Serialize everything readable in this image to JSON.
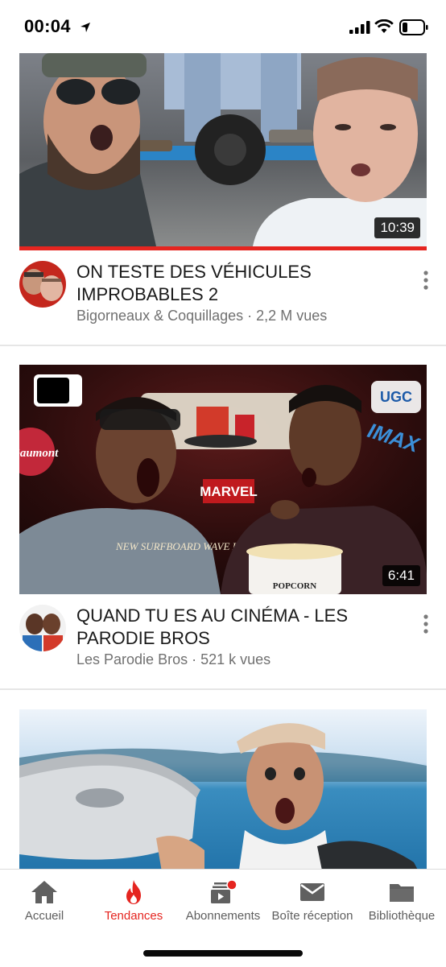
{
  "status": {
    "time": "00:04",
    "location_icon": "location-arrow-icon",
    "signal_icon": "cellular-signal-icon",
    "wifi_icon": "wifi-icon",
    "battery_icon": "battery-low-icon"
  },
  "videos": [
    {
      "title_line1": "ON TESTE DES VÉHICULES",
      "title_line2": "IMPROBABLES 2",
      "channel": "Bigorneaux & Coquillages",
      "separator": "·",
      "views": "2,2 M vues",
      "duration": "10:39",
      "watched_fraction": 1.0
    },
    {
      "title_line1": "QUAND TU ES AU CINÉMA - LES",
      "title_line2": "PARODIE BROS",
      "channel": "Les Parodie Bros",
      "separator": "·",
      "views": "521 k vues",
      "duration": "6:41",
      "thumb_text": {
        "brand": "MARVEL",
        "logo1": "Gaumont",
        "logo2": "UGC",
        "logo3": "IMAX",
        "shirt": "NEW SURFBOARD WAVE RIDER",
        "bucket": "POPCORN"
      }
    },
    {
      "title_line1": "",
      "title_line2": "",
      "channel": "",
      "views": "",
      "duration": ""
    }
  ],
  "tabs": [
    {
      "label": "Accueil",
      "icon": "home-icon"
    },
    {
      "label": "Tendances",
      "icon": "trending-flame-icon",
      "active": true
    },
    {
      "label": "Abonnements",
      "icon": "subscriptions-icon"
    },
    {
      "label": "Boîte réception",
      "icon": "inbox-mail-icon"
    },
    {
      "label": "Bibliothèque",
      "icon": "library-folder-icon"
    }
  ],
  "colors": {
    "accent": "#e52520",
    "meta_text": "#707070",
    "divider": "#e6e6e6"
  }
}
